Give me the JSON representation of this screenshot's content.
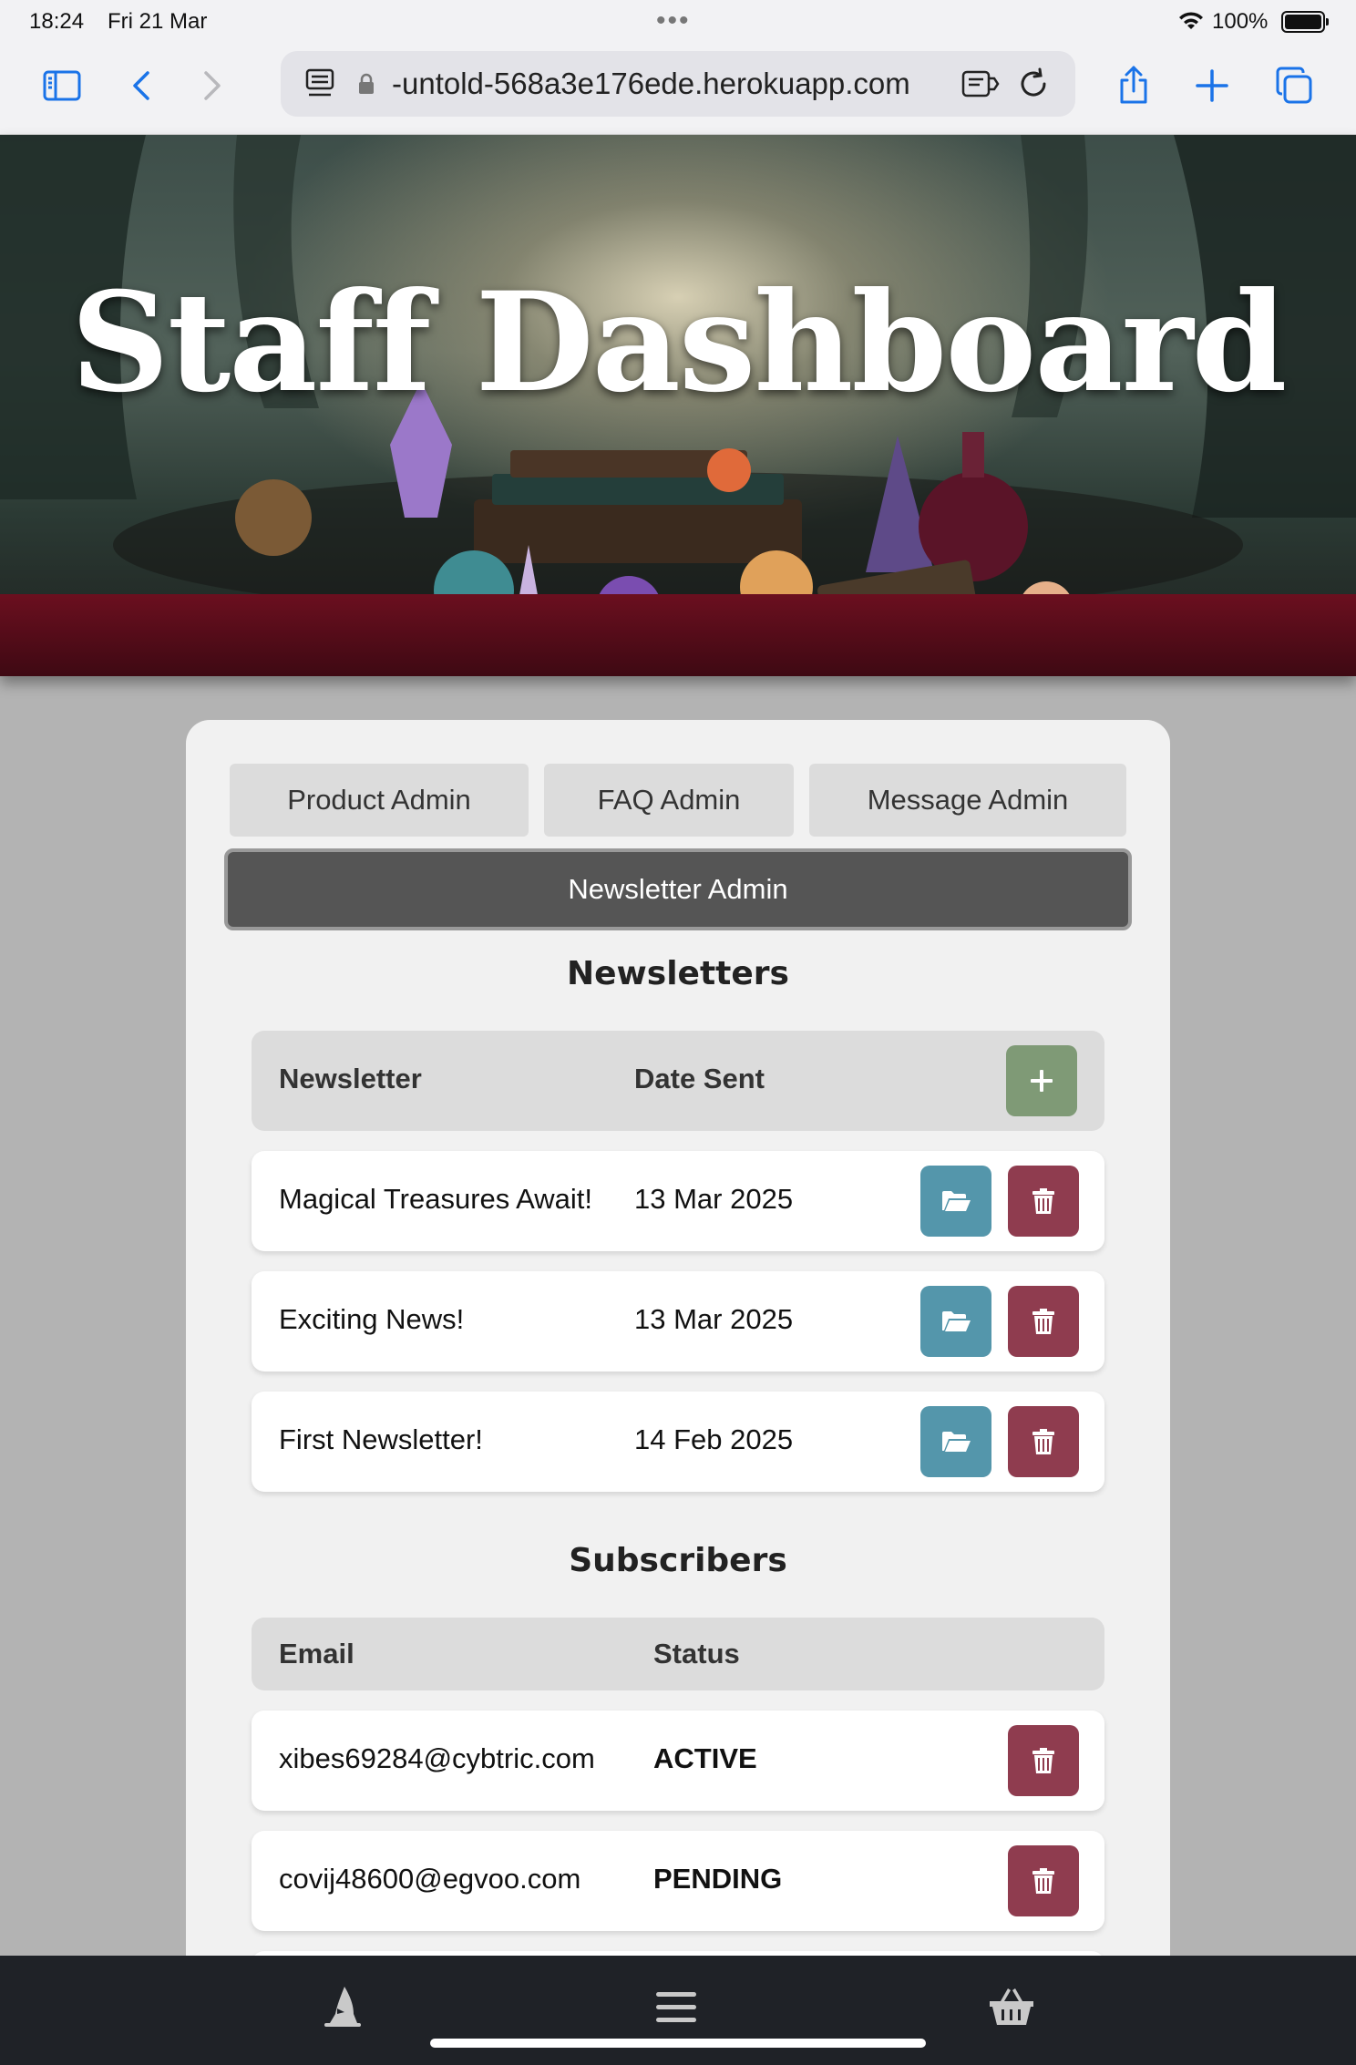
{
  "status_bar": {
    "time": "18:24",
    "date": "Fri 21 Mar",
    "battery": "100%"
  },
  "browser": {
    "url": "-untold-568a3e176ede.herokuapp.com"
  },
  "hero": {
    "title": "Staff Dashboard"
  },
  "tabs": [
    {
      "label": "Product Admin"
    },
    {
      "label": "FAQ Admin"
    },
    {
      "label": "Message Admin"
    },
    {
      "label": "Newsletter Admin",
      "active": true
    }
  ],
  "newsletters": {
    "title": "Newsletters",
    "columns": [
      "Newsletter",
      "Date Sent"
    ],
    "rows": [
      {
        "name": "Magical Treasures Await!",
        "date": "13 Mar 2025"
      },
      {
        "name": "Exciting News!",
        "date": "13 Mar 2025"
      },
      {
        "name": "First Newsletter!",
        "date": "14 Feb 2025"
      }
    ]
  },
  "subscribers": {
    "title": "Subscribers",
    "columns": [
      "Email",
      "Status"
    ],
    "rows": [
      {
        "email": "xibes69284@cybtric.com",
        "status": "ACTIVE"
      },
      {
        "email": "covij48600@egvoo.com",
        "status": "PENDING"
      }
    ]
  },
  "colors": {
    "open": "#5496ab",
    "delete": "#8f3c4f",
    "add": "#7f9a76",
    "active": "#7f9a76",
    "active_tab": "#555555"
  },
  "icons": [
    "sidebar-icon",
    "back-icon",
    "forward-icon",
    "lock-icon",
    "reader-icon",
    "reload-icon",
    "share-icon",
    "new-tab-icon",
    "tabs-icon",
    "folder-open-icon",
    "trash-icon",
    "plus-icon",
    "wizard-hat-icon",
    "menu-icon",
    "basket-icon"
  ]
}
